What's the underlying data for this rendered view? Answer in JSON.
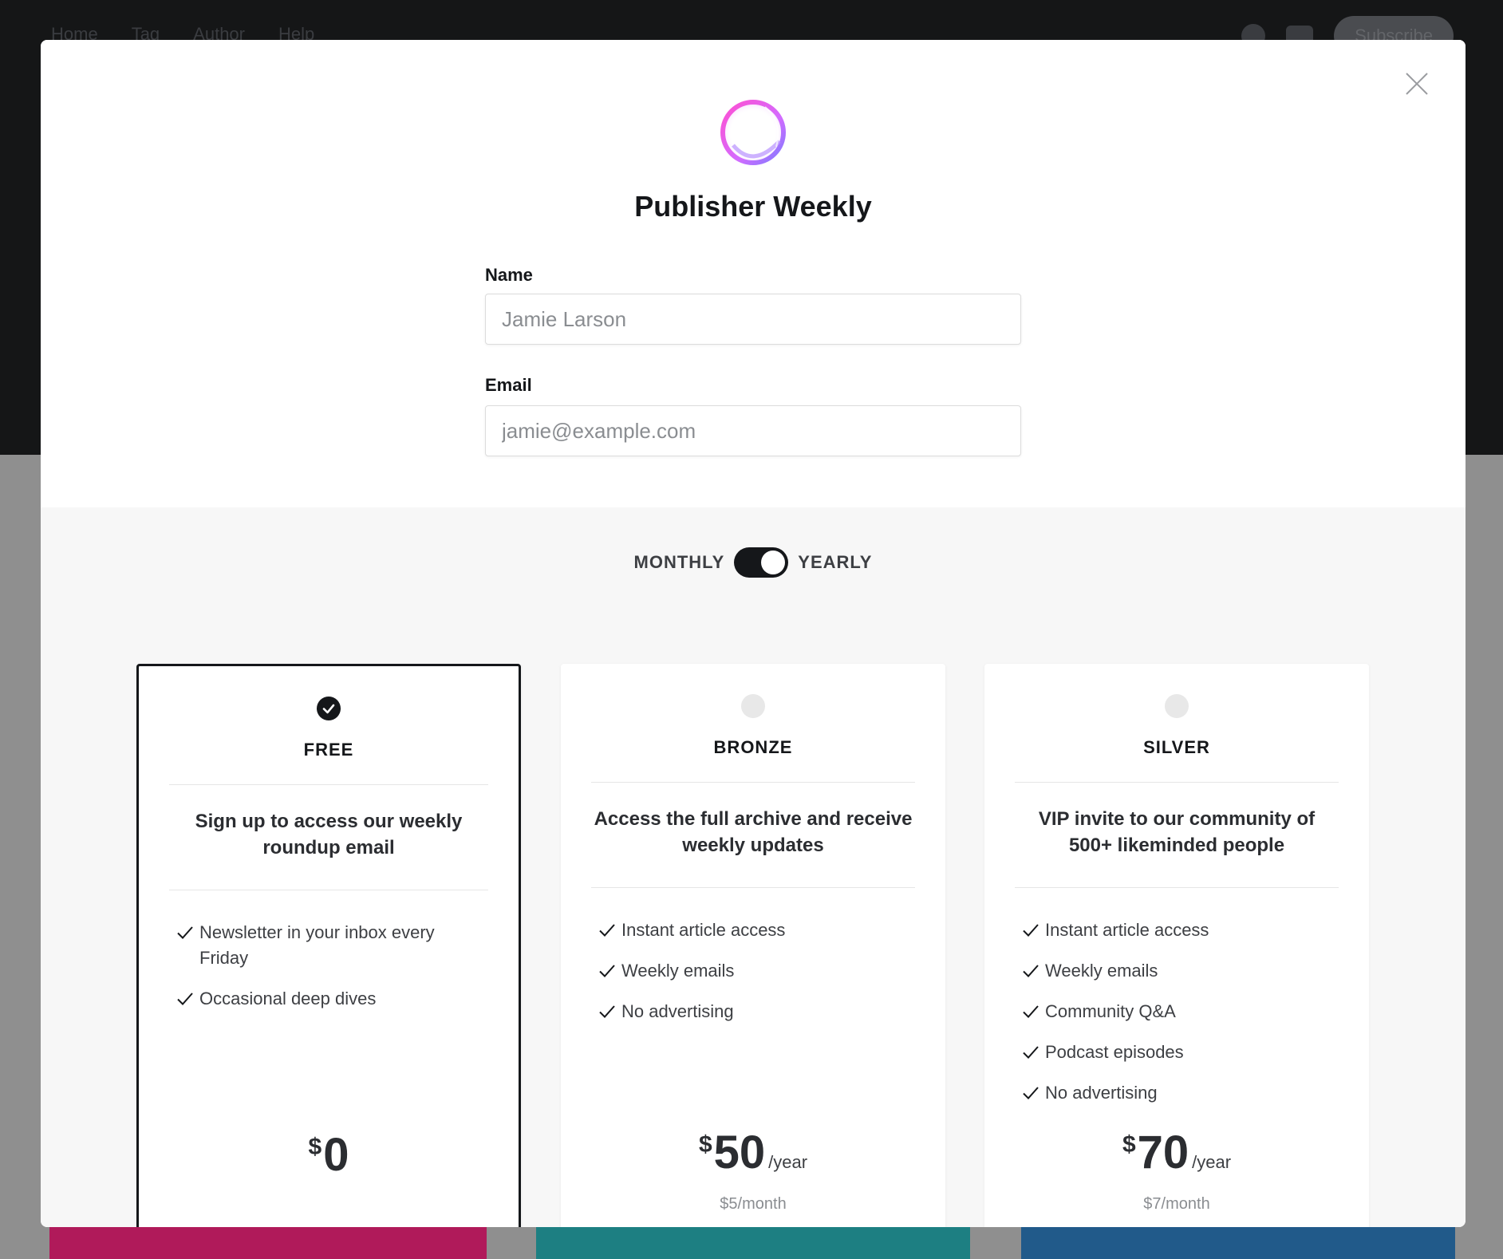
{
  "background": {
    "nav": [
      "Home",
      "Tag",
      "Author",
      "Help"
    ],
    "subscribe_label": "Subscribe"
  },
  "modal": {
    "site_title": "Publisher Weekly",
    "logo_icon": "gradient-ring-logo",
    "close_icon": "close-icon",
    "name_field": {
      "label": "Name",
      "placeholder": "Jamie Larson",
      "value": ""
    },
    "email_field": {
      "label": "Email",
      "placeholder": "jamie@example.com",
      "value": ""
    },
    "billing_toggle": {
      "left_label": "MONTHLY",
      "right_label": "YEARLY",
      "selected": "YEARLY"
    },
    "tiers": [
      {
        "name": "FREE",
        "selected": true,
        "description": "Sign up to access our weekly roundup email",
        "benefits": [
          "Newsletter in your inbox every Friday",
          "Occasional deep dives"
        ],
        "currency": "$",
        "amount": "0",
        "period": "",
        "monthly_note": ""
      },
      {
        "name": "BRONZE",
        "selected": false,
        "description": "Access the full archive and receive weekly updates",
        "benefits": [
          "Instant article access",
          "Weekly emails",
          "No advertising"
        ],
        "currency": "$",
        "amount": "50",
        "period": "/year",
        "monthly_note": "$5/month"
      },
      {
        "name": "SILVER",
        "selected": false,
        "description": "VIP invite to our community of 500+ likeminded people",
        "benefits": [
          "Instant article access",
          "Weekly emails",
          "Community Q&A",
          "Podcast episodes",
          "No advertising"
        ],
        "currency": "$",
        "amount": "70",
        "period": "/year",
        "monthly_note": "$7/month"
      }
    ]
  },
  "colors": {
    "accent": "#15171a",
    "logo_gradient_start": "#ff5ad2",
    "logo_gradient_end": "#8b6cff"
  }
}
